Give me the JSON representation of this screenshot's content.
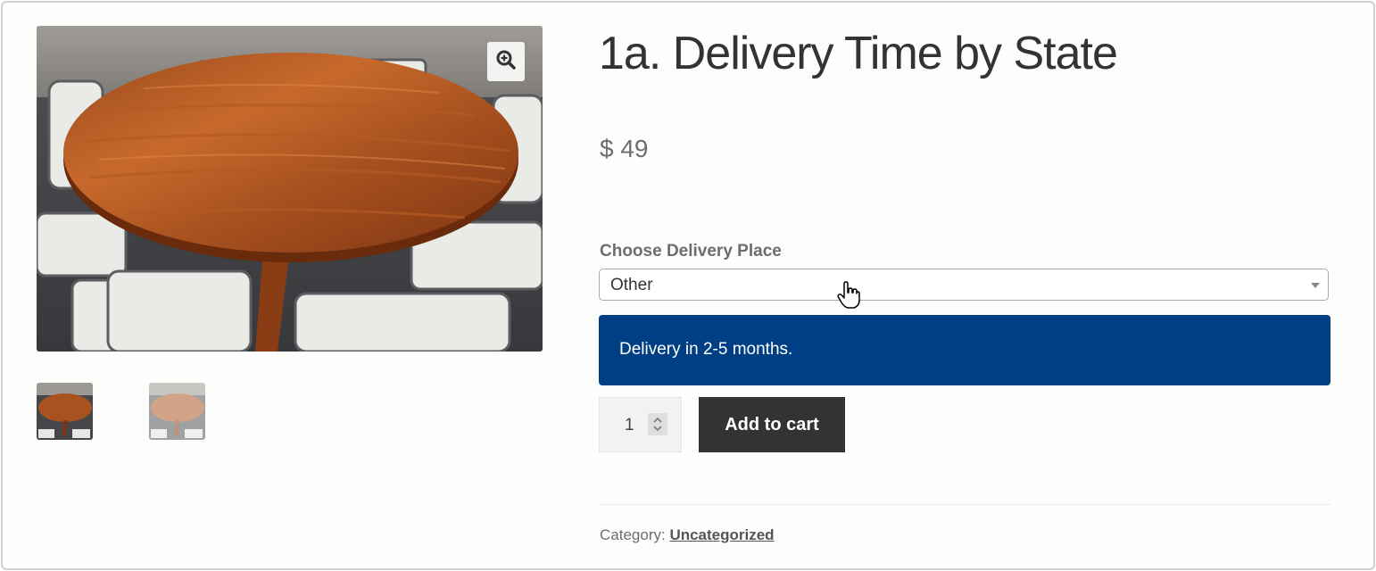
{
  "product": {
    "title": "1a. Delivery Time by State",
    "price": "$ 49"
  },
  "gallery": {
    "main_image_alt": "Round wooden dining table with chairs",
    "thumbnails": [
      "thumbnail-1",
      "thumbnail-2"
    ],
    "zoom_icon": "zoom-in-icon"
  },
  "delivery": {
    "label": "Choose Delivery Place",
    "selected": "Other",
    "notice": "Delivery in 2-5 months."
  },
  "cart": {
    "quantity": "1",
    "add_label": "Add to cart"
  },
  "meta": {
    "category_label": "Category:",
    "category_value": "Uncategorized"
  },
  "colors": {
    "notice_bg": "#003f83",
    "button_bg": "#333333"
  }
}
